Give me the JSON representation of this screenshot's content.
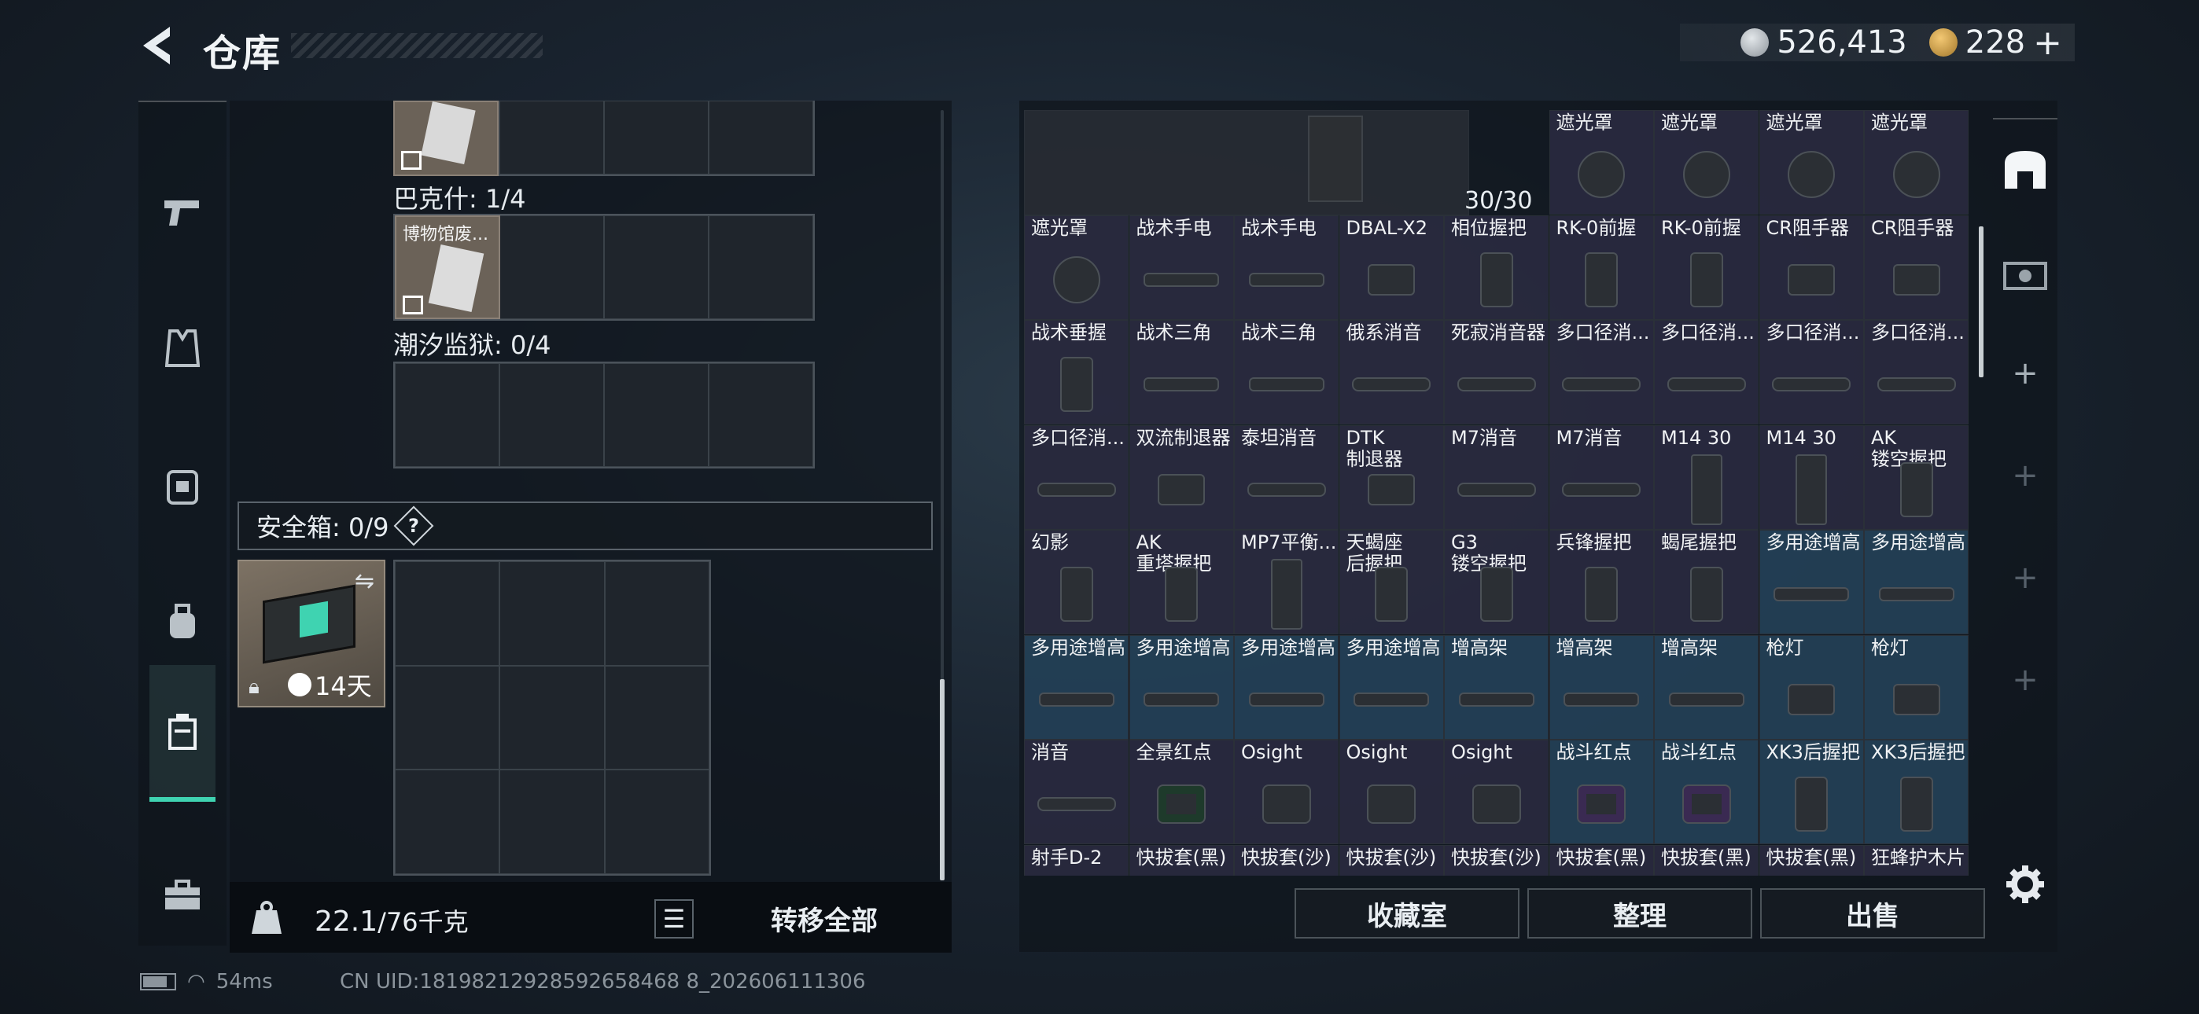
{
  "header": {
    "title": "仓库",
    "currency": [
      {
        "icon": "silver-coin-icon",
        "value": "526,413",
        "color": "#b8bec6"
      },
      {
        "icon": "gold-coin-icon",
        "value": "228",
        "color": "#d7a64a"
      }
    ],
    "add_symbol": "+"
  },
  "nav": [
    {
      "name": "weapon",
      "icon": "pistol-icon"
    },
    {
      "name": "armor",
      "icon": "vest-icon"
    },
    {
      "name": "backpack",
      "icon": "backpack-icon"
    },
    {
      "name": "pouch",
      "icon": "pouch-icon"
    },
    {
      "name": "safebox",
      "icon": "safebox-icon",
      "active": true
    },
    {
      "name": "toolbox",
      "icon": "toolbox-icon"
    }
  ],
  "left": {
    "cards": [
      {
        "label": "",
        "top_partial": true
      },
      {
        "label": "博物馆废..."
      }
    ],
    "sections": [
      {
        "label": "巴克什: 1/4"
      },
      {
        "label": "潮汐监狱: 0/4"
      }
    ],
    "safe": {
      "label": "安全箱: 0/9",
      "help": "?",
      "duration": "14天"
    },
    "weight": {
      "value": "22.1",
      "max": "/76千克"
    },
    "transfer_all": "转移全部"
  },
  "right": {
    "gun_qty": "30/30",
    "items": [
      [
        "",
        "",
        "",
        "",
        "",
        "遮光罩",
        "遮光罩",
        "遮光罩",
        "遮光罩"
      ],
      [
        "遮光罩",
        "战术手电",
        "战术手电",
        "DBAL-X2",
        "相位握把",
        "RK-0前握",
        "RK-0前握",
        "CR阻手器",
        "CR阻手器"
      ],
      [
        "战术垂握",
        "战术三角",
        "战术三角",
        "俄系消音",
        "死寂消音器",
        "多口径消...",
        "多口径消...",
        "多口径消...",
        "多口径消..."
      ],
      [
        "多口径消...",
        "双流制退器",
        "泰坦消音",
        "DTK\n制退器",
        "M7消音",
        "M7消音",
        "M14 30",
        "M14 30",
        "AK\n镂空握把"
      ],
      [
        "幻影",
        "AK\n重塔握把",
        "MP7平衡...",
        "天蝎座\n后握把",
        "G3\n镂空握把",
        "兵锋握把",
        "蝎尾握把",
        "多用途增高",
        "多用途增高"
      ],
      [
        "多用途增高",
        "多用途增高",
        "多用途增高",
        "多用途增高",
        "增高架",
        "增高架",
        "增高架",
        "枪灯",
        "枪灯"
      ],
      [
        "消音",
        "全景红点",
        "Osight",
        "Osight",
        "Osight",
        "战斗红点",
        "战斗红点",
        "XK3后握把",
        "XK3后握把"
      ],
      [
        "射手D-2",
        "快拔套(黑)",
        "快拔套(沙)",
        "快拔套(沙)",
        "快拔套(沙)",
        "快拔套(黑)",
        "快拔套(黑)",
        "快拔套(黑)",
        "狂蜂护木片"
      ]
    ],
    "buttons": [
      "收藏室",
      "整理",
      "出售"
    ]
  },
  "status": {
    "ping": "54ms",
    "uid": "CN UID:18198212928592658468 8_202606111306"
  }
}
